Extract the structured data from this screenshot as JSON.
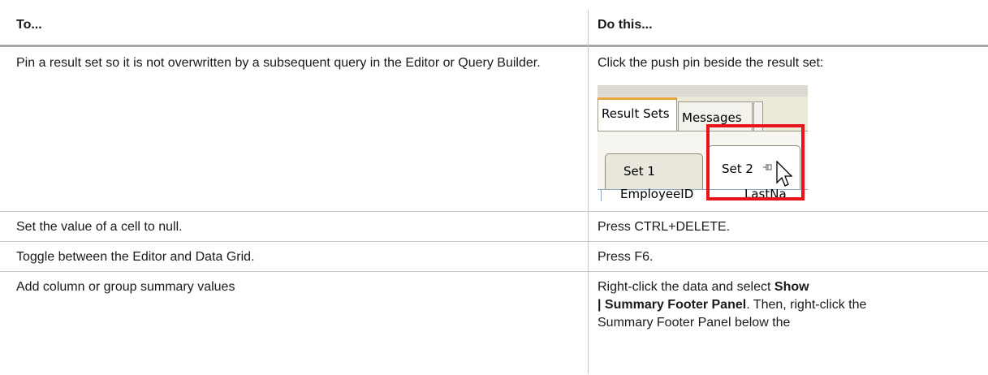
{
  "table": {
    "headers": {
      "col1": "To...",
      "col2": "Do this..."
    },
    "rows": [
      {
        "task": "Pin a result set so it is not overwritten by a subsequent query in the Editor or Query Builder.",
        "action": "Click the push pin beside the result set:"
      },
      {
        "task": "Set the value of a cell to null.",
        "action": "Press CTRL+DELETE."
      },
      {
        "task": "Toggle between the Editor and Data Grid.",
        "action": "Press F6."
      },
      {
        "task": "Add column or group summary values",
        "action_pre": "Right-click the data and select ",
        "action_bold1": "Show",
        "action_bold2": "| Summary Footer Panel",
        "action_post": ". Then, right-click the Summary Footer Panel below the"
      }
    ]
  },
  "screenshot": {
    "tab_result_sets": "Result Sets",
    "tab_messages": "Messages",
    "subtab_set1": "Set 1",
    "subtab_set2": "Set 2",
    "grid_col_employee": "EmployeeID",
    "grid_col_lastname": "LastNa",
    "pin_icon": "push-pin-icon",
    "highlight_color": "#e8141c"
  }
}
